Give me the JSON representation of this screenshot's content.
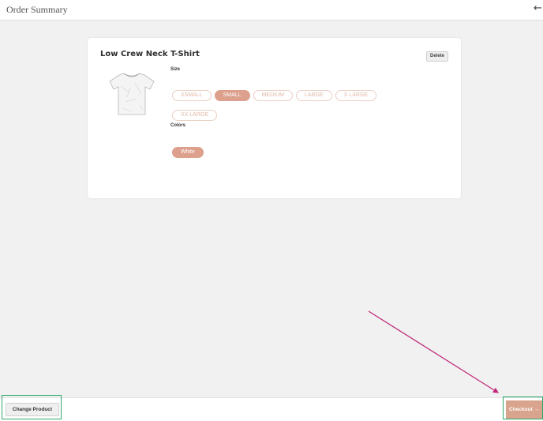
{
  "header": {
    "title": "Order Summary",
    "back_glyph": "←"
  },
  "product": {
    "name": "Low Crew Neck T-Shirt",
    "delete_label": "Delete",
    "size_label": "Size",
    "sizes": [
      {
        "label": "XSMALL",
        "selected": false
      },
      {
        "label": "SMALL",
        "selected": true
      },
      {
        "label": "MEDIUM",
        "selected": false
      },
      {
        "label": "LARGE",
        "selected": false
      },
      {
        "label": "X LARGE",
        "selected": false
      },
      {
        "label": "XX LARGE",
        "selected": false
      }
    ],
    "colors_label": "Colors",
    "colors": [
      {
        "label": "White",
        "selected": true
      }
    ]
  },
  "footer": {
    "change_product_label": "Change Product",
    "checkout_label": "Checkout →"
  },
  "colors": {
    "accent": "#dca08c",
    "highlight_box": "#2ea86a",
    "annotation_arrow": "#c0267a"
  }
}
